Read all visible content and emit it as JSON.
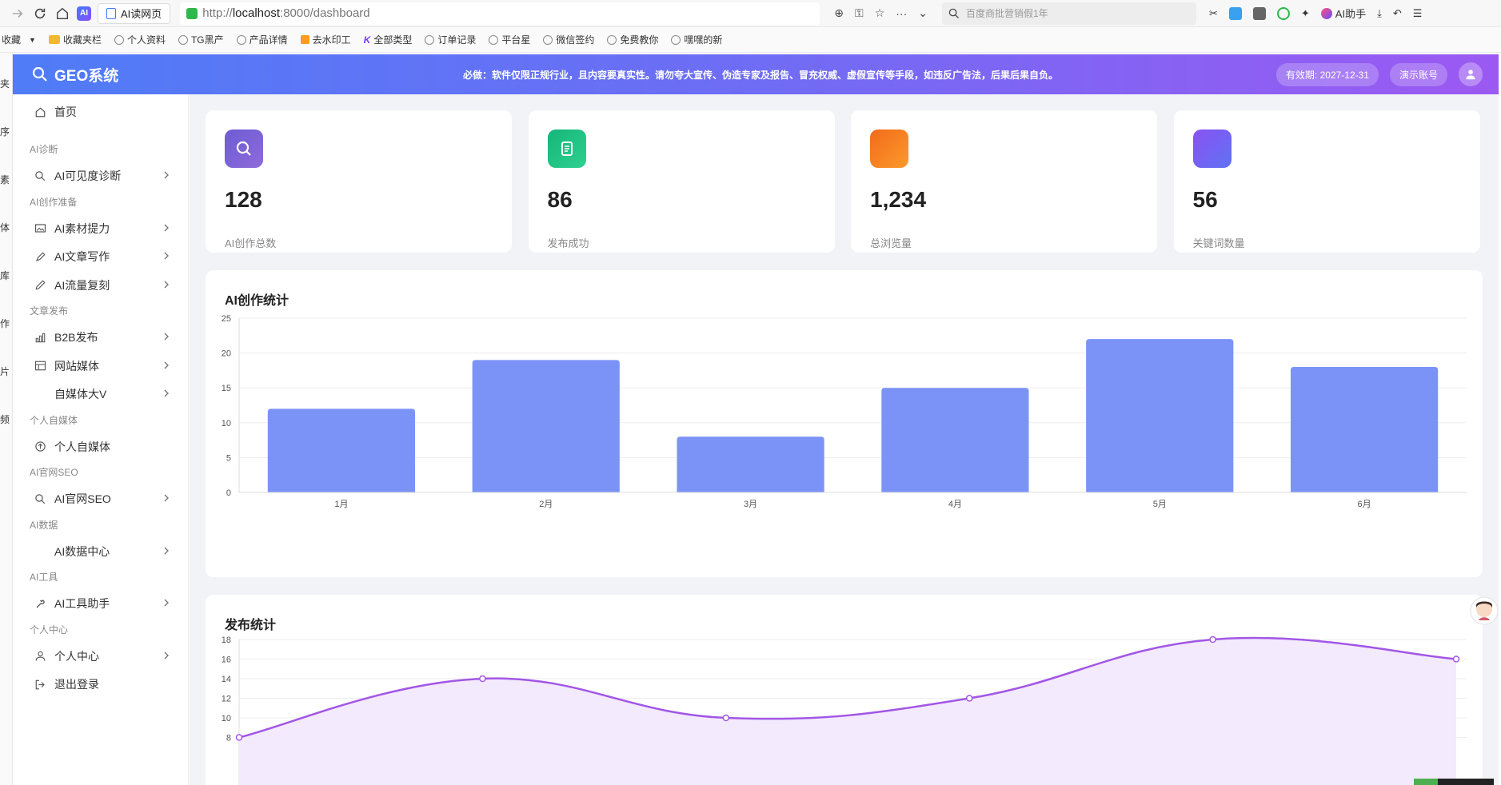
{
  "browser": {
    "tab_title": "AI读网页",
    "url_scheme": "http://",
    "url_host": "localhost",
    "url_rest": ":8000/dashboard",
    "search_placeholder": "百度商批营销假1年",
    "ai_assistant": "AI助手",
    "logo_text": "AI"
  },
  "bookmarks": [
    {
      "label": "收藏",
      "icon": "none"
    },
    {
      "label": "收藏夹栏",
      "icon": "folder"
    },
    {
      "label": "个人资料",
      "icon": "globe"
    },
    {
      "label": "TG黑产",
      "icon": "globe"
    },
    {
      "label": "产品详情",
      "icon": "globe"
    },
    {
      "label": "去水印工",
      "icon": "orange"
    },
    {
      "label": "全部类型",
      "icon": "k"
    },
    {
      "label": "订单记录",
      "icon": "globe"
    },
    {
      "label": "平台星",
      "icon": "globe"
    },
    {
      "label": "微信签约",
      "icon": "globe"
    },
    {
      "label": "免费教你",
      "icon": "globe"
    },
    {
      "label": "嘿嘿的新",
      "icon": "globe"
    }
  ],
  "side_strip": [
    "夹",
    "序",
    "素",
    "体",
    "库",
    "作",
    "片",
    "频"
  ],
  "header": {
    "brand": "GEO系统",
    "notice": "必做：软件仅限正规行业，且内容要真实性。请勿夸大宣传、伪造专家及报告、冒充权威、虚假宣传等手段，如违反广告法，后果后果自负。",
    "validity": "有效期: 2027-12-31",
    "account": "演示账号"
  },
  "sidebar": {
    "home": "首页",
    "groups": [
      {
        "title": "AI诊断",
        "items": [
          {
            "label": "AI可见度诊断",
            "icon": "search-icon"
          }
        ]
      },
      {
        "title": "AI创作准备",
        "items": [
          {
            "label": "AI素材提力",
            "icon": "image-icon"
          },
          {
            "label": "AI文章写作",
            "icon": "pen-icon"
          },
          {
            "label": "AI流量复刻",
            "icon": "pencil-icon"
          }
        ]
      },
      {
        "title": "文章发布",
        "items": [
          {
            "label": "B2B发布",
            "icon": "bar-chart-icon"
          },
          {
            "label": "网站媒体",
            "icon": "table-icon"
          },
          {
            "label": "自媒体大V",
            "icon": "none"
          }
        ]
      },
      {
        "title": "个人自媒体",
        "items": [
          {
            "label": "个人自媒体",
            "icon": "upload-circle-icon"
          }
        ]
      },
      {
        "title": "AI官网SEO",
        "items": [
          {
            "label": "AI官网SEO",
            "icon": "search-icon"
          }
        ]
      },
      {
        "title": "AI数据",
        "items": [
          {
            "label": "AI数据中心",
            "icon": "none"
          }
        ]
      },
      {
        "title": "AI工具",
        "items": [
          {
            "label": "AI工具助手",
            "icon": "wrench-icon"
          }
        ]
      },
      {
        "title": "个人中心",
        "items": [
          {
            "label": "个人中心",
            "icon": "user-icon"
          },
          {
            "label": "退出登录",
            "icon": "logout-icon"
          }
        ]
      }
    ]
  },
  "stats": [
    {
      "value": "128",
      "label": "AI创作总数",
      "gradient": [
        "#6d5cd6",
        "#8f6ad8"
      ],
      "icon": "search-icon"
    },
    {
      "value": "86",
      "label": "发布成功",
      "gradient": [
        "#16b67a",
        "#2ed08f"
      ],
      "icon": "document-icon"
    },
    {
      "value": "1,234",
      "label": "总浏览量",
      "gradient": [
        "#f36a1b",
        "#fb9a2a"
      ],
      "icon": "none"
    },
    {
      "value": "56",
      "label": "关键词数量",
      "gradient": [
        "#8a52f2",
        "#5f72f5"
      ],
      "icon": "none"
    }
  ],
  "colors": {
    "bar": "#7b93f7",
    "line": "#a256e6",
    "area": "#f3eafd",
    "grid": "#eeeeee",
    "axis_text": "#555555"
  },
  "chart_data": [
    {
      "type": "bar",
      "title": "AI创作统计",
      "categories": [
        "1月",
        "2月",
        "3月",
        "4月",
        "5月",
        "6月"
      ],
      "values": [
        12,
        19,
        8,
        15,
        22,
        18
      ],
      "ylim": [
        0,
        25
      ],
      "yticks": [
        0,
        5,
        10,
        15,
        20,
        25
      ],
      "grid": true,
      "xlabel": "",
      "ylabel": ""
    },
    {
      "type": "area",
      "title": "发布统计",
      "categories": [
        "",
        "",
        "",
        "",
        "",
        ""
      ],
      "values": [
        8,
        14,
        10,
        12,
        18,
        16
      ],
      "ylim": [
        7,
        18
      ],
      "yticks": [
        8,
        10,
        12,
        14,
        16,
        18
      ],
      "grid": true,
      "xlabel": "",
      "ylabel": ""
    }
  ]
}
